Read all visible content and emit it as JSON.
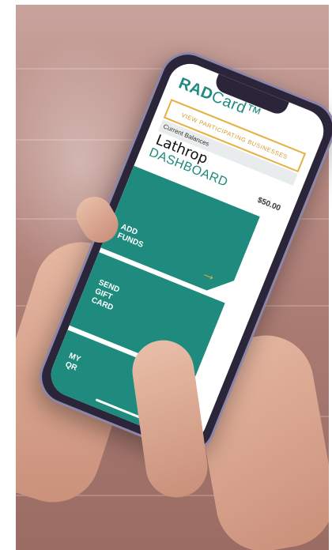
{
  "app": {
    "logo_bold": "RAD",
    "logo_thin": "Card™"
  },
  "header": {
    "partners_button": "VIEW PARTICIPATING BUSINESSES"
  },
  "balances": {
    "label": "Current Balances",
    "location": "Lathrop",
    "amount": "$50.00"
  },
  "dashboard": {
    "title": "DASHBOARD"
  },
  "tiles": [
    {
      "label": "ADD\nFUNDS",
      "icon": "arrow-right-icon"
    },
    {
      "label": "SEND\nGIFT\nCARD"
    },
    {
      "label": "MY\nQR"
    }
  ],
  "colors": {
    "accent_teal": "#1f8b7e",
    "accent_gold": "#e6b040"
  }
}
